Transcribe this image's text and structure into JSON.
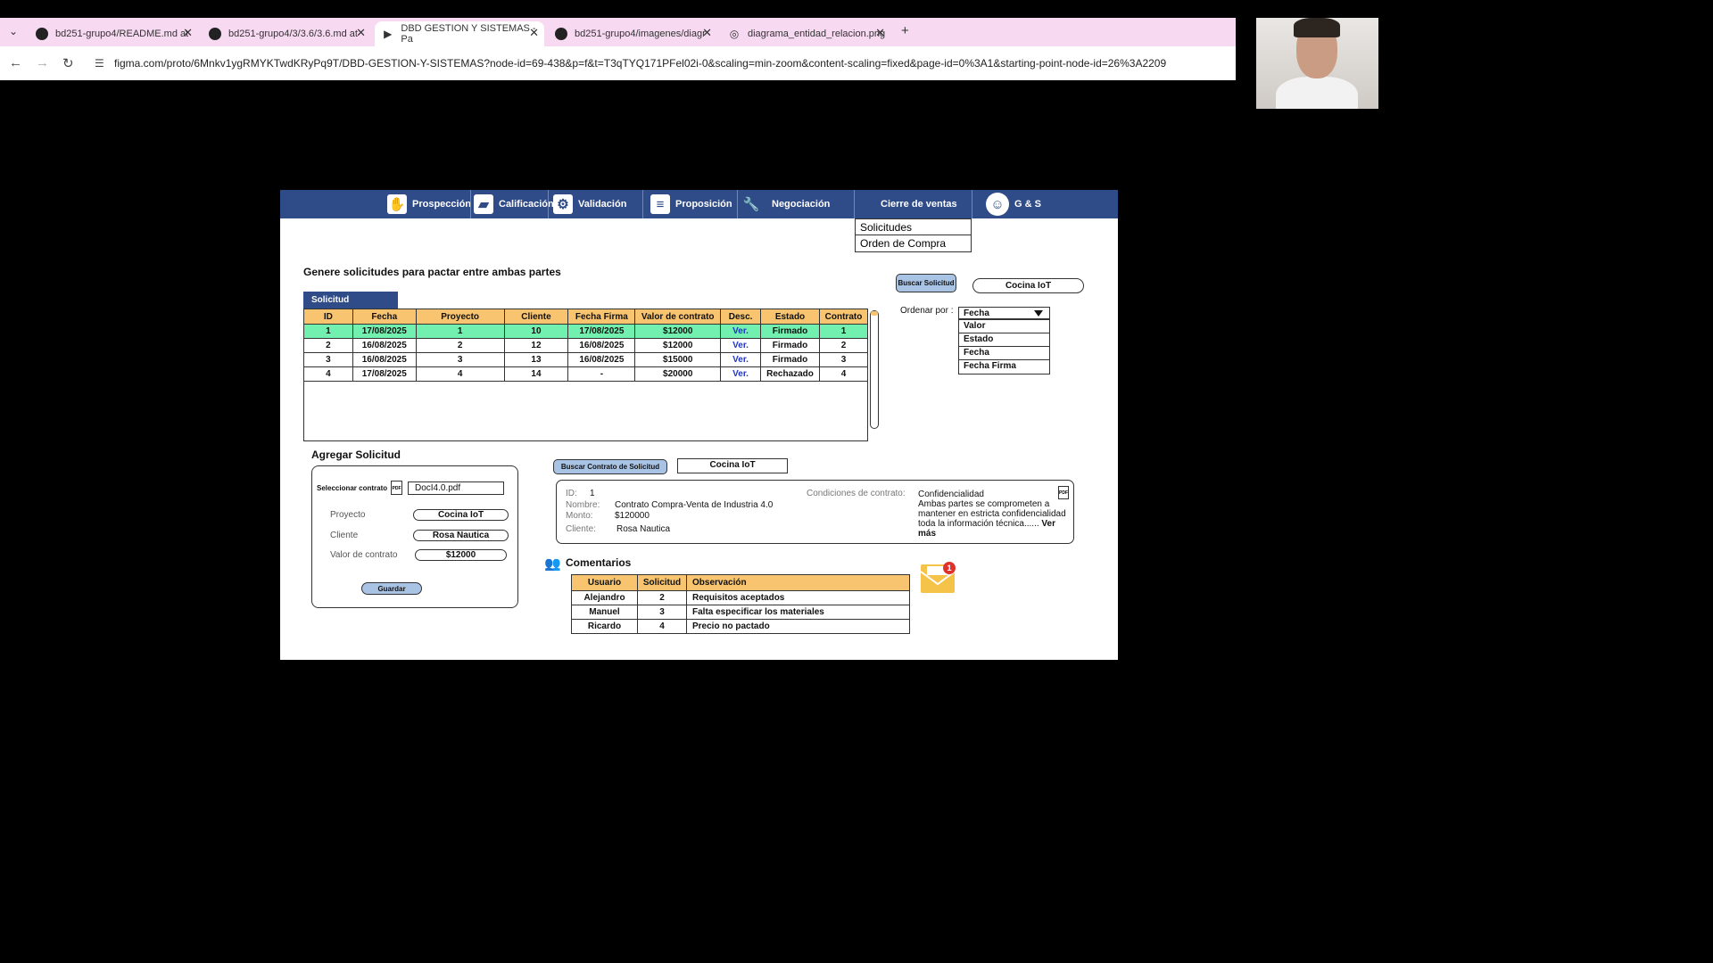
{
  "browser": {
    "tabs": [
      {
        "label": "bd251-grupo4/README.md at"
      },
      {
        "label": "bd251-grupo4/3/3.6/3.6.md at"
      },
      {
        "label": "DBD GESTION Y SISTEMAS - Pa"
      },
      {
        "label": "bd251-grupo4/imagenes/diagr"
      },
      {
        "label": "diagrama_entidad_relacion.png"
      }
    ],
    "url": "figma.com/proto/6Mnkv1ygRMYKTwdKRyPq9T/DBD-GESTION-Y-SISTEMAS?node-id=69-438&p=f&t=T3qTYQ171PFel02i-0&scaling=min-zoom&content-scaling=fixed&page-id=0%3A1&starting-point-node-id=26%3A2209"
  },
  "menu": {
    "prospeccion": "Prospección",
    "calificacion": "Calificación",
    "validacion": "Validación",
    "proposicion": "Proposición",
    "negociacion": "Negociación",
    "cierre": "Cierre de ventas",
    "brand": "G & S",
    "dropdown": [
      "Solicitudes",
      "Orden de Compra"
    ]
  },
  "header": "Genere solicitudes para pactar entre ambas partes",
  "search": {
    "button": "Buscar Solicitud",
    "value": "Cocina IoT"
  },
  "solicitud_tab": "Solicitud",
  "table": {
    "headers": [
      "ID",
      "Fecha",
      "Proyecto",
      "Cliente",
      "Fecha Firma",
      "Valor de contrato",
      "Desc.",
      "Estado",
      "Contrato"
    ],
    "rows": [
      [
        "1",
        "17/08/2025",
        "1",
        "10",
        "17/08/2025",
        "$12000",
        "Ver.",
        "Firmado",
        "1"
      ],
      [
        "2",
        "16/08/2025",
        "2",
        "12",
        "16/08/2025",
        "$12000",
        "Ver.",
        "Firmado",
        "2"
      ],
      [
        "3",
        "16/08/2025",
        "3",
        "13",
        "16/08/2025",
        "$15000",
        "Ver.",
        "Firmado",
        "3"
      ],
      [
        "4",
        "17/08/2025",
        "4",
        "14",
        "-",
        "$20000",
        "Ver.",
        "Rechazado",
        "4"
      ]
    ]
  },
  "order": {
    "label": "Ordenar por :",
    "selected": "Fecha",
    "options": [
      "Valor",
      "Estado",
      "Fecha",
      "Fecha Firma"
    ]
  },
  "agregar": {
    "title": "Agregar Solicitud",
    "select_label": "Seleccionar contrato",
    "file": "DocI4.0.pdf",
    "proyecto_label": "Proyecto",
    "proyecto": "Cocina IoT",
    "cliente_label": "Cliente",
    "cliente": "Rosa Nautica",
    "valor_label": "Valor de contrato",
    "valor": "$12000",
    "save": "Guardar"
  },
  "contract_search": {
    "button": "Buscar Contrato de Solicitud",
    "value": "Cocina IoT"
  },
  "contract": {
    "id_label": "ID:",
    "id": "1",
    "nombre_label": "Nombre:",
    "nombre": "Contrato Compra-Venta de Industria 4.0",
    "monto_label": "Monto:",
    "monto": "$120000",
    "cliente_label": "Cliente:",
    "cliente": "Rosa Nautica",
    "cond_label": "Condiciones de contrato:",
    "cond_title": "Confidencialidad",
    "cond_text": " Ambas partes se comprometen a mantener en estricta confidencialidad toda la información técnica......",
    "more": "Ver más"
  },
  "comments": {
    "title": "Comentarios",
    "headers": [
      "Usuario",
      "Solicitud",
      "Observación"
    ],
    "rows": [
      [
        "Alejandro",
        "2",
        "Requisitos aceptados"
      ],
      [
        "Manuel",
        "3",
        "Falta especificar los materiales"
      ],
      [
        "Ricardo",
        "4",
        "Precio no pactado"
      ]
    ],
    "badge": "1"
  },
  "colors": {
    "menu": "#2f4b88",
    "header": "#f8c46f",
    "highlight": "#72f0b0",
    "button": "#a9c3e4"
  }
}
